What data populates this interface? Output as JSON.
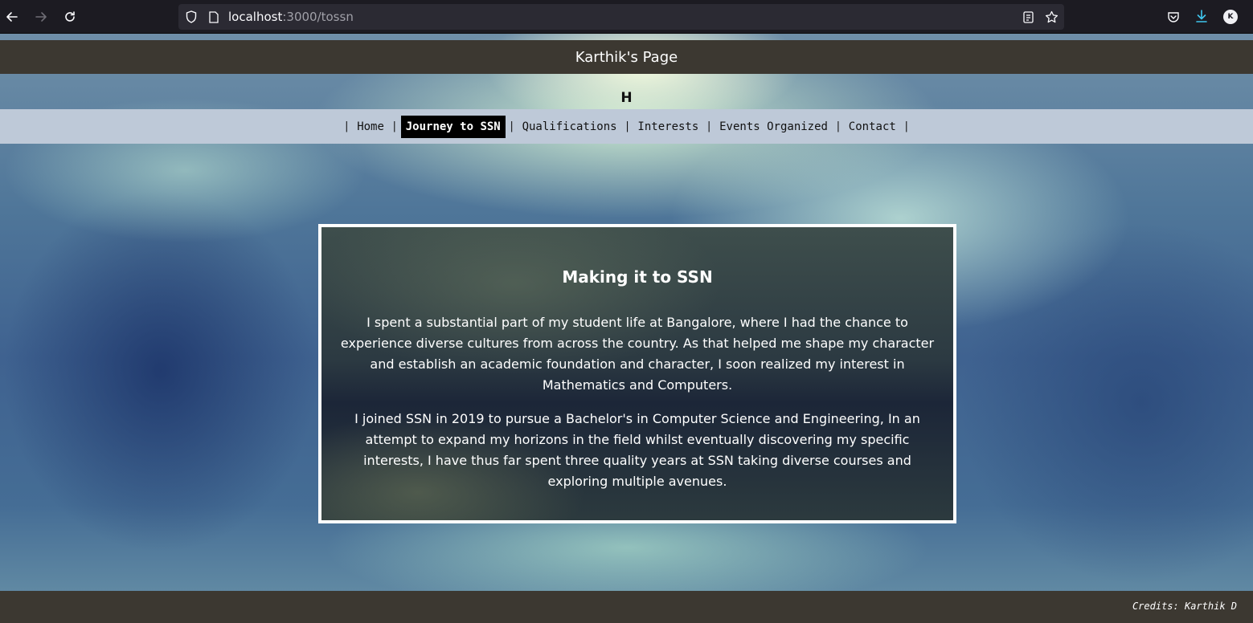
{
  "browser": {
    "url_host": "localhost",
    "url_path": ":3000/tossn"
  },
  "header": {
    "title": "Karthik's Page"
  },
  "logo_letter": "H",
  "nav": {
    "separator": "|",
    "items": [
      {
        "label": "Home",
        "active": false
      },
      {
        "label": "Journey to SSN",
        "active": true
      },
      {
        "label": "Qualifications",
        "active": false
      },
      {
        "label": "Interests",
        "active": false
      },
      {
        "label": "Events Organized",
        "active": false
      },
      {
        "label": "Contact",
        "active": false
      }
    ]
  },
  "card": {
    "title": "Making it to SSN",
    "paragraphs": [
      "I spent a substantial part of my student life at Bangalore, where I had the chance to experience diverse cultures from across the country. As that helped me shape my character and establish an academic foundation and character, I soon realized my interest in Mathematics and Computers.",
      "I joined SSN in 2019 to pursue a Bachelor's in Computer Science and Engineering, In an attempt to expand my horizons in the field whilst eventually discovering my specific interests, I have thus far spent three quality years at SSN taking diverse courses and exploring multiple avenues."
    ]
  },
  "footer": {
    "credits": "Credits: Karthik D"
  },
  "colors": {
    "header_bg": "#3c3831",
    "nav_bg": "#bec9d8",
    "active_nav_bg": "#000000",
    "card_border": "#ffffff"
  },
  "icons": {
    "back": "arrow-left-icon",
    "forward": "arrow-right-icon",
    "reload": "reload-icon",
    "shield": "shield-icon",
    "page": "page-icon",
    "reader": "reader-view-icon",
    "bookmark": "star-icon",
    "pocket": "pocket-icon",
    "download": "download-icon",
    "account": "account-avatar"
  },
  "account_initial": "K"
}
